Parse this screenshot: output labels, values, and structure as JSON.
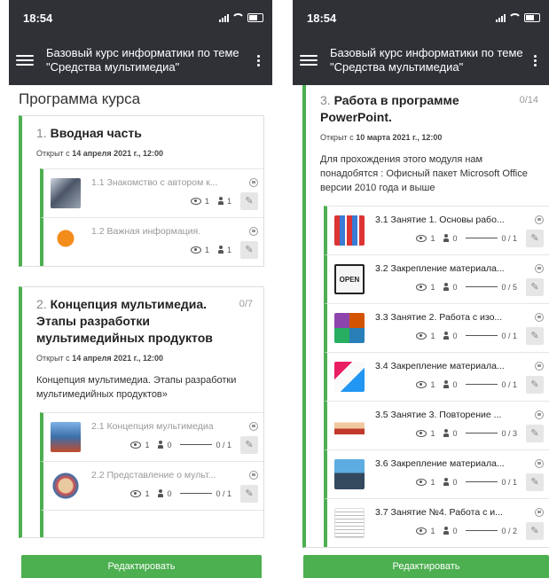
{
  "left": {
    "status": {
      "time": "18:54"
    },
    "appbar": {
      "title": "Базовый курс информатики по теме \"Средства мультимедиа\""
    },
    "program_title": "Программа курса",
    "sections": [
      {
        "num": "1.",
        "name": "Вводная часть",
        "count": "",
        "open_prefix": "Открыт с",
        "open_date": "14 апреля 2021 г., 12:00",
        "description": "",
        "lessons": [
          {
            "title": "1.1 Знакомство с автором к...",
            "views": "1",
            "users": "1",
            "progress": ""
          },
          {
            "title": "1.2 Важная информация.",
            "views": "1",
            "users": "1",
            "progress": ""
          }
        ]
      },
      {
        "num": "2.",
        "name": "Концепция мультимедиа. Этапы разработки мультимедийных продуктов",
        "count": "0/7",
        "open_prefix": "Открыт с",
        "open_date": "14 апреля 2021 г., 12:00",
        "description": "Концепция мультимедиа. Этапы разработки мультимедийных продуктов»",
        "lessons": [
          {
            "title": "2.1 Концепция мультимедиа",
            "views": "1",
            "users": "0",
            "progress": "0 / 1"
          },
          {
            "title": "2.2 Представление о мульт...",
            "views": "1",
            "users": "0",
            "progress": "0 / 1"
          }
        ]
      }
    ],
    "edit_button": "Редактировать"
  },
  "right": {
    "status": {
      "time": "18:54"
    },
    "appbar": {
      "title": "Базовый курс информатики по теме \"Средства мультимедиа\""
    },
    "section": {
      "num": "3.",
      "name": "Работа в программе PowerPoint.",
      "count": "0/14",
      "open_prefix": "Открыт с",
      "open_date": "10 марта 2021 г., 12:00",
      "description": "Для прохождения этого модуля нам понадобятся : Офисный пакет Microsoft Office версии 2010 года и выше"
    },
    "lessons": [
      {
        "title": "3.1 Занятие 1. Основы рабо...",
        "views": "1",
        "users": "0",
        "progress": "0 / 1"
      },
      {
        "title": "3.2 Закрепление материала...",
        "views": "1",
        "users": "0",
        "progress": "0 / 5"
      },
      {
        "title": "3.3 Занятие 2. Работа с изо...",
        "views": "1",
        "users": "0",
        "progress": "0 / 1"
      },
      {
        "title": "3.4 Закрепление материала...",
        "views": "1",
        "users": "0",
        "progress": "0 / 1"
      },
      {
        "title": "3.5 Занятие 3. Повторение ...",
        "views": "1",
        "users": "0",
        "progress": "0 / 3"
      },
      {
        "title": "3.6 Закрепление материала...",
        "views": "1",
        "users": "0",
        "progress": "0 / 1"
      },
      {
        "title": "3.7 Занятие №4. Работа с и...",
        "views": "1",
        "users": "0",
        "progress": "0 / 2"
      }
    ],
    "open_sign": "OPEN",
    "edit_button": "Редактировать"
  },
  "colors": {
    "accent": "#4caf50",
    "appbar": "#2f3137"
  },
  "icons": [
    "menu-icon",
    "more-vert-icon",
    "eye-icon",
    "person-icon",
    "lock-icon",
    "pencil-icon"
  ]
}
